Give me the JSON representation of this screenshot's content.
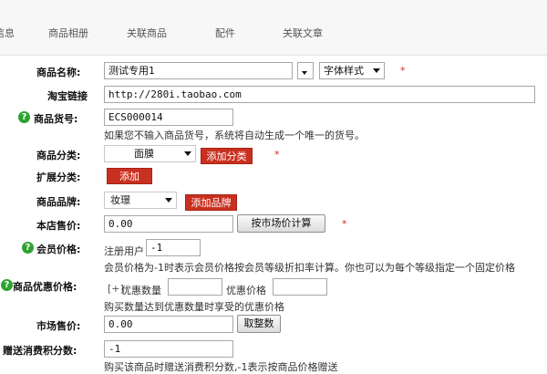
{
  "tabs": [
    "信息",
    "商品相册",
    "关联商品",
    "配件",
    "关联文章"
  ],
  "required_mark": "*",
  "fields": {
    "goods_name": {
      "label": "商品名称:",
      "value": "测试专用1",
      "font_style": "字体样式"
    },
    "taobao_link": {
      "label": "淘宝链接",
      "value": "http://280i.taobao.com"
    },
    "goods_sn": {
      "label": "商品货号:",
      "value": "ECS000014",
      "note": "如果您不输入商品货号，系统将自动生成一个唯一的货号。"
    },
    "category": {
      "label": "商品分类:",
      "value": "面膜",
      "add_button": "添加分类"
    },
    "ext_category": {
      "label": "扩展分类:",
      "add_button": "添加"
    },
    "brand": {
      "label": "商品品牌:",
      "value": "妆璟",
      "add_button": "添加品牌"
    },
    "shop_price": {
      "label": "本店售价:",
      "value": "0.00",
      "button": "按市场价计算"
    },
    "member_price": {
      "label": "会员价格:",
      "user_rank": "注册用户",
      "value": "-1",
      "note": "会员价格为-1时表示会员价格按会员等级折扣率计算。你也可以为每个等级指定一个固定价格"
    },
    "volume_price": {
      "label": "商品优惠价格:",
      "add_toggle": "[+]",
      "qty_label": "优惠数量",
      "price_label": "优惠价格",
      "note": "购买数量达到优惠数量时享受的优惠价格"
    },
    "market_price": {
      "label": "市场售价:",
      "value": "0.00",
      "button": "取整数"
    },
    "give_points": {
      "label": "赠送消费积分数:",
      "value": "-1",
      "note": "购买该商品时赠送消费积分数,-1表示按商品价格赠送"
    }
  }
}
